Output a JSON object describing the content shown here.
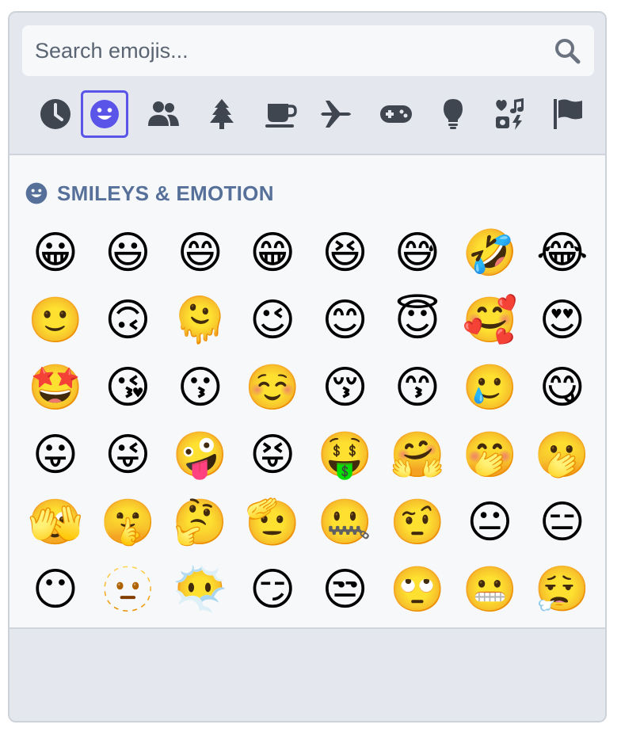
{
  "search": {
    "placeholder": "Search emojis..."
  },
  "categories": [
    {
      "name": "recent",
      "icon": "clock-icon",
      "active": false
    },
    {
      "name": "smileys",
      "icon": "smiley-icon",
      "active": true
    },
    {
      "name": "people",
      "icon": "people-icon",
      "active": false
    },
    {
      "name": "nature",
      "icon": "tree-icon",
      "active": false
    },
    {
      "name": "food",
      "icon": "coffee-icon",
      "active": false
    },
    {
      "name": "travel",
      "icon": "airplane-icon",
      "active": false
    },
    {
      "name": "activities",
      "icon": "gamepad-icon",
      "active": false
    },
    {
      "name": "objects",
      "icon": "lightbulb-icon",
      "active": false
    },
    {
      "name": "symbols",
      "icon": "symbols-icon",
      "active": false
    },
    {
      "name": "flags",
      "icon": "flag-icon",
      "active": false
    }
  ],
  "colors": {
    "accent": "#5b54e8",
    "icon": "#3f4650",
    "section_title": "#56709a"
  },
  "section": {
    "title": "SMILEYS & EMOTION",
    "icon": "smiley-icon"
  },
  "emojis": [
    "😀",
    "😃",
    "😄",
    "😁",
    "😆",
    "😅",
    "🤣",
    "😂",
    "🙂",
    "🙃",
    "🫠",
    "😉",
    "😊",
    "😇",
    "🥰",
    "😍",
    "🤩",
    "😘",
    "😗",
    "☺️",
    "😚",
    "😙",
    "🥲",
    "😋",
    "😛",
    "😜",
    "🤪",
    "😝",
    "🤑",
    "🤗",
    "🤭",
    "🫢",
    "🫣",
    "🤫",
    "🤔",
    "🫡",
    "🤐",
    "🤨",
    "😐",
    "😑",
    "😶",
    "🫥",
    "😶‍🌫️",
    "😏",
    "😒",
    "🙄",
    "😬",
    "😮‍💨"
  ]
}
